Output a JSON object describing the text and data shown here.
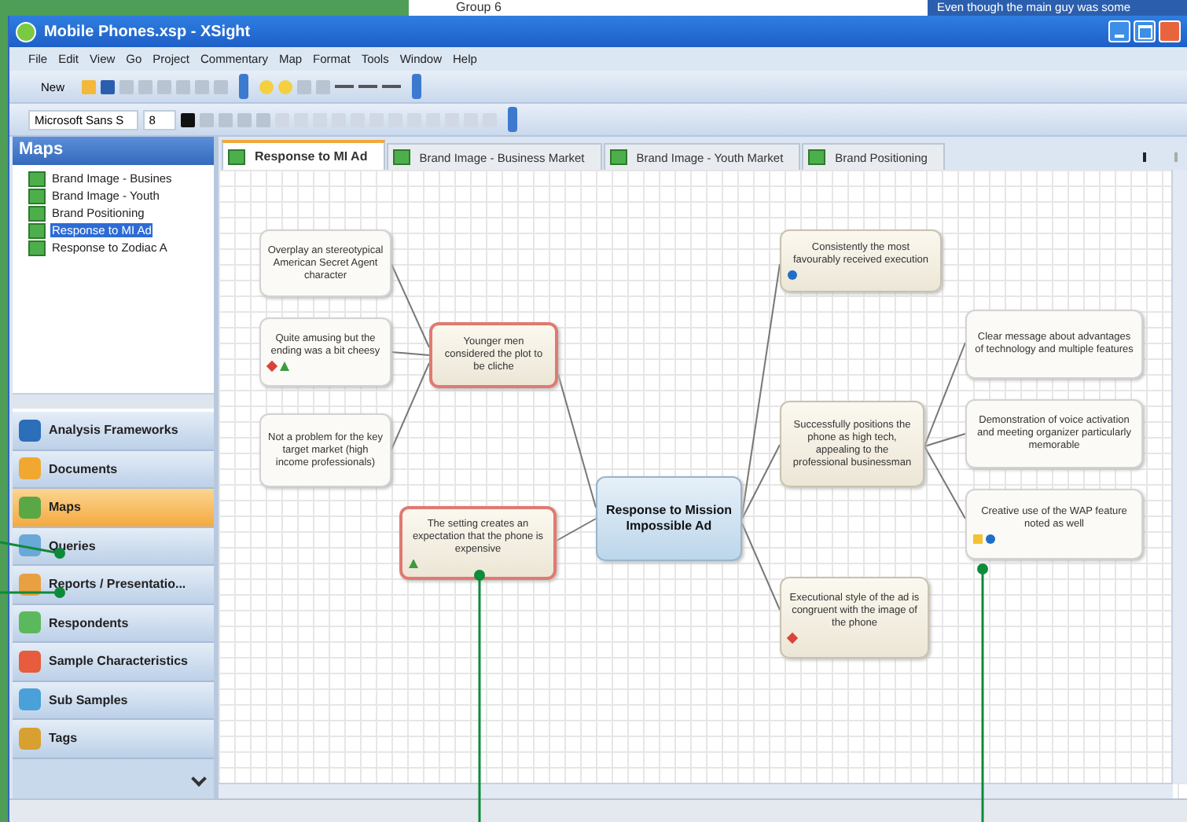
{
  "background_window": {
    "tree_item": "Group 6",
    "text": "Even though the main guy was some"
  },
  "window": {
    "title": "Mobile Phones.xsp - XSight"
  },
  "menu": [
    "File",
    "Edit",
    "View",
    "Go",
    "Project",
    "Commentary",
    "Map",
    "Format",
    "Tools",
    "Window",
    "Help"
  ],
  "toolbar": {
    "new_button": "New",
    "font": "Microsoft Sans S",
    "size": "8"
  },
  "sidebar": {
    "title": "Maps",
    "items": [
      {
        "label": "Brand Image - Busines",
        "selected": false
      },
      {
        "label": "Brand Image - Youth",
        "selected": false
      },
      {
        "label": "Brand Positioning",
        "selected": false
      },
      {
        "label": "Response to MI Ad",
        "selected": true
      },
      {
        "label": "Response to Zodiac A",
        "selected": false
      }
    ],
    "nav": [
      {
        "label": "Analysis Frameworks",
        "selected": false
      },
      {
        "label": "Documents",
        "selected": false
      },
      {
        "label": "Maps",
        "selected": true
      },
      {
        "label": "Queries",
        "selected": false
      },
      {
        "label": "Reports / Presentatio...",
        "selected": false
      },
      {
        "label": "Respondents",
        "selected": false
      },
      {
        "label": "Sample Characteristics",
        "selected": false
      },
      {
        "label": "Sub Samples",
        "selected": false
      },
      {
        "label": "Tags",
        "selected": false
      }
    ]
  },
  "tabs": [
    {
      "label": "Response to MI Ad",
      "selected": true
    },
    {
      "label": "Brand Image - Business Market",
      "selected": false
    },
    {
      "label": "Brand Image - Youth Market",
      "selected": false
    },
    {
      "label": "Brand Positioning",
      "selected": false
    }
  ],
  "map": {
    "nodes": [
      {
        "text": "Overplay an stereotypical American Secret Agent character",
        "kind": "leaf",
        "flagged": false
      },
      {
        "text": "Quite amusing but the ending was a bit cheesy",
        "kind": "leaf",
        "flagged": false,
        "markers": [
          {
            "kind": "diamond"
          },
          {
            "kind": "triangle"
          }
        ]
      },
      {
        "text": "Not a problem for the key target market (high income professionals)",
        "kind": "leaf",
        "flagged": false
      },
      {
        "text": "Younger men considered the plot to be cliche",
        "kind": "branch",
        "flagged": true
      },
      {
        "text": "The setting creates an expectation that the phone is expensive",
        "kind": "branch",
        "flagged": true,
        "markers": [
          {
            "kind": "triangle"
          }
        ]
      },
      {
        "text": "Response to Mission Impossible Ad",
        "kind": "central",
        "flagged": false
      },
      {
        "text": "Consistently the most favourably received execution",
        "kind": "branch",
        "flagged": false,
        "markers": [
          {
            "kind": "dot"
          }
        ]
      },
      {
        "text": "Successfully positions the phone as high tech, appealing to the professional businessman",
        "kind": "branch",
        "flagged": false
      },
      {
        "text": "Executional style of the ad is congruent with the image of the phone",
        "kind": "branch",
        "flagged": false,
        "markers": [
          {
            "kind": "diamond"
          }
        ]
      },
      {
        "text": "Clear message about advantages of technology and multiple features",
        "kind": "leaf",
        "flagged": false
      },
      {
        "text": "Demonstration of voice activation and meeting organizer particularly memorable",
        "kind": "leaf",
        "flagged": false
      },
      {
        "text": "Creative use of the WAP feature noted as well",
        "kind": "leaf",
        "flagged": false,
        "markers": [
          {
            "kind": "square"
          },
          {
            "kind": "dot"
          }
        ]
      }
    ]
  }
}
